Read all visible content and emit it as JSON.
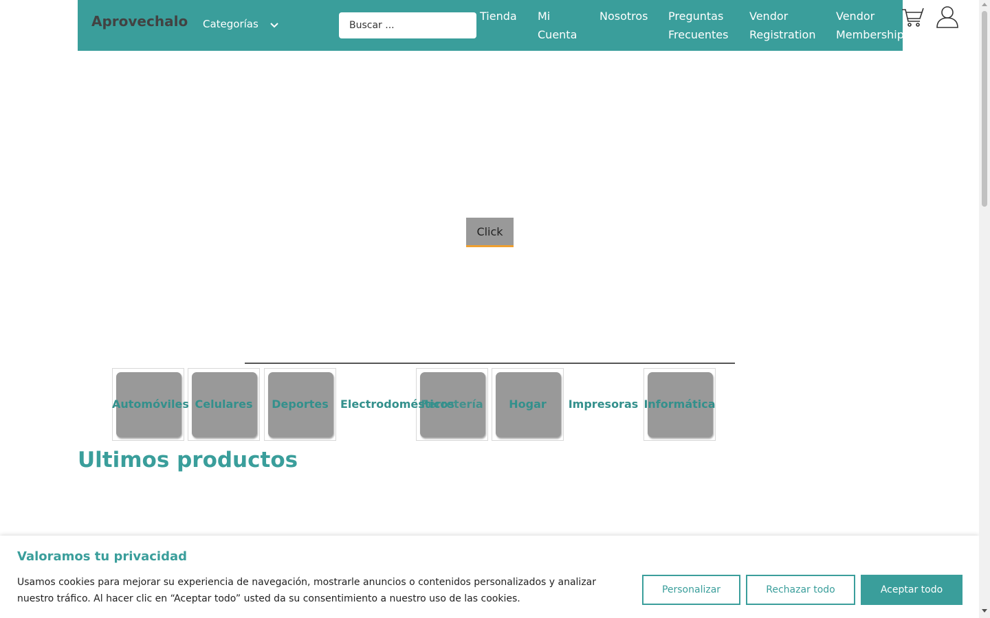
{
  "header": {
    "logo": "Aprovechalo",
    "categories_label": "Categorías",
    "search_placeholder": "Buscar ...",
    "nav": [
      "Tienda",
      "Mi Cuenta",
      "Nosotros",
      "Preguntas Frecuentes",
      "Vendor Registration",
      "Vendor Membership"
    ],
    "icons": {
      "dropdown": "chevron-down-icon",
      "cart": "cart-icon",
      "account": "user-icon"
    }
  },
  "hero": {
    "button_label": "Click"
  },
  "categories": [
    "Automóviles",
    "Celulares",
    "Deportes",
    "Electrodomésticos",
    "Ferretería",
    "Hogar",
    "Impresoras",
    "Informática"
  ],
  "latest": {
    "title": "Ultimos productos"
  },
  "cookie": {
    "title": "Valoramos tu privacidad",
    "text": "Usamos cookies para mejorar su experiencia de navegación, mostrarle anuncios o contenidos personalizados y analizar nuestro tráfico. Al hacer clic en “Aceptar todo” usted da su consentimiento a nuestro uso de las cookies.",
    "customize": "Personalizar",
    "reject": "Rechazar todo",
    "accept": "Aceptar todo"
  },
  "colors": {
    "brand": "#3a9e9b",
    "accent": "#f0a030",
    "placeholder_gray": "#999999"
  }
}
